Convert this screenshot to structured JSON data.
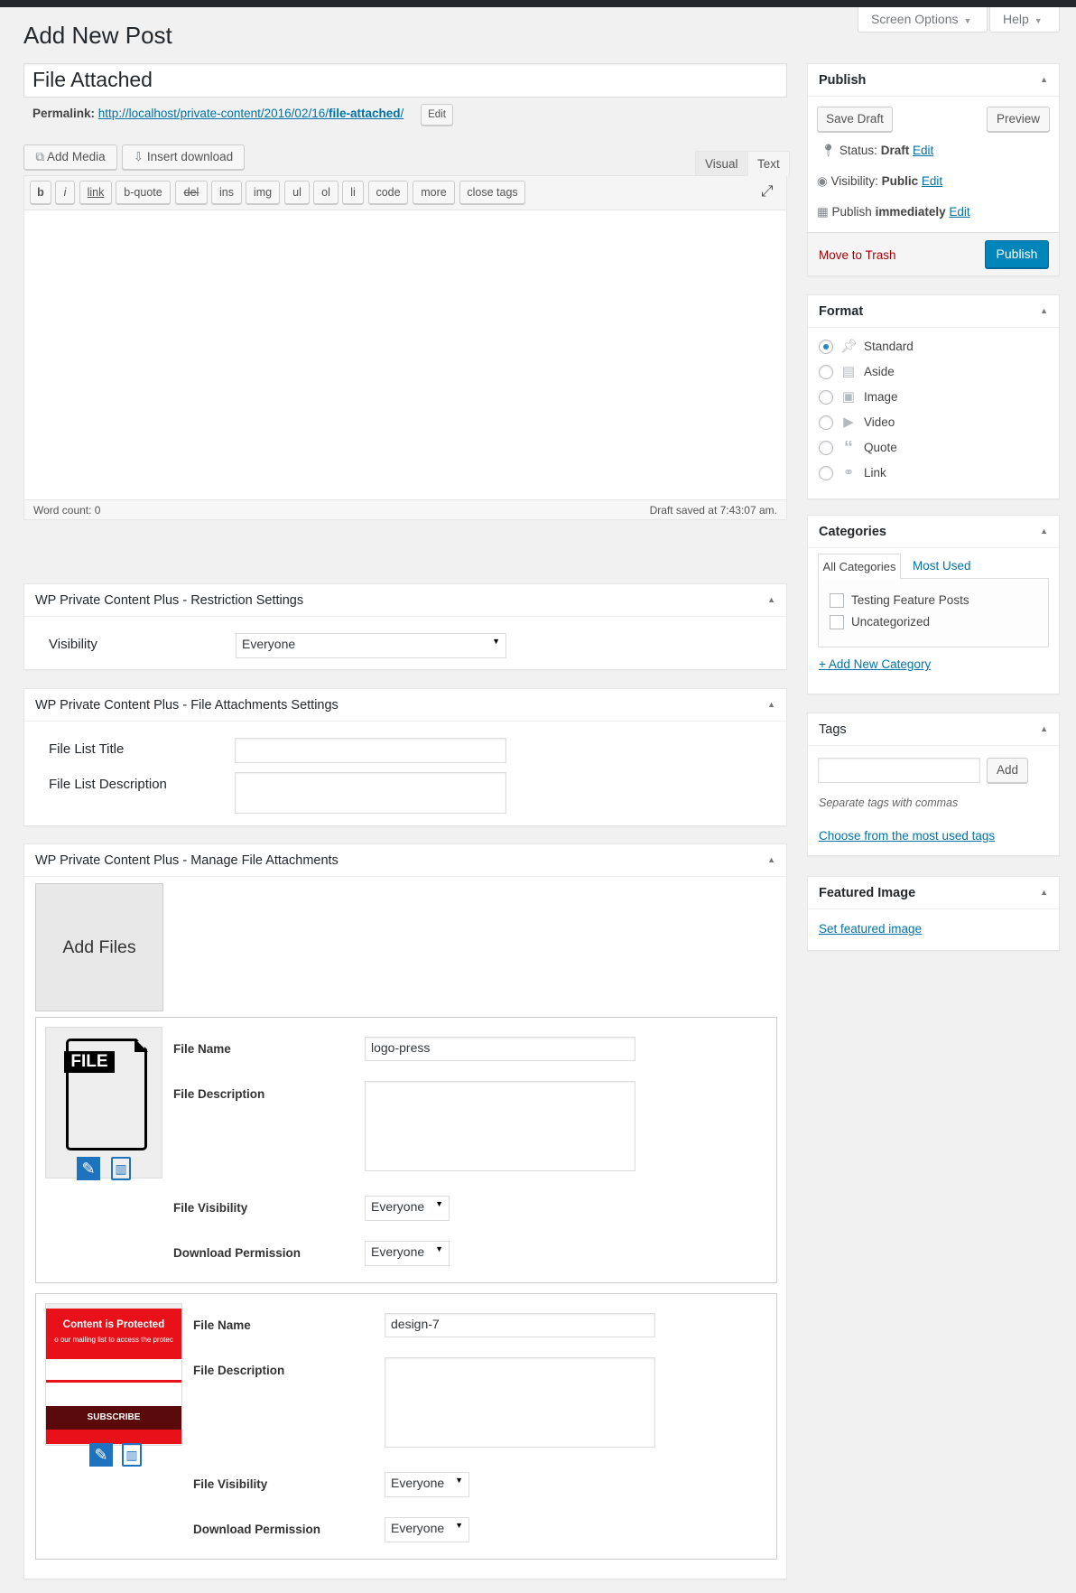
{
  "screen_options": {
    "label": "Screen Options",
    "help": "Help"
  },
  "page_title": "Add New Post",
  "post_title": "File Attached",
  "permalink": {
    "label": "Permalink:",
    "url_base": "http://localhost/private-content/2016/02/16/",
    "slug": "file-attached",
    "slug_suffix": "/",
    "edit": "Edit"
  },
  "media_buttons": {
    "add_media": "Add Media",
    "insert_download": "Insert download"
  },
  "editor_tabs": {
    "visual": "Visual",
    "text": "Text"
  },
  "quicktags": [
    "b",
    "i",
    "link",
    "b-quote",
    "del",
    "ins",
    "img",
    "ul",
    "ol",
    "li",
    "code",
    "more",
    "close tags"
  ],
  "statusbar": {
    "word_count": "Word count: 0",
    "draft_saved": "Draft saved at 7:43:07 am."
  },
  "restriction": {
    "title": "WP Private Content Plus - Restriction Settings",
    "visibility_label": "Visibility",
    "visibility_value": "Everyone"
  },
  "attachments_settings": {
    "title": "WP Private Content Plus - File Attachments Settings",
    "list_title_label": "File List Title",
    "list_desc_label": "File List Description"
  },
  "manage": {
    "title": "WP Private Content Plus - Manage File Attachments",
    "add_files": "Add Files",
    "files": [
      {
        "thumb_text": "FILE",
        "name_label": "File Name",
        "name_value": "logo-press",
        "desc_label": "File Description",
        "vis_label": "File Visibility",
        "vis_value": "Everyone",
        "perm_label": "Download Permission",
        "perm_value": "Everyone"
      },
      {
        "thumb_title": "Content is Protected",
        "thumb_sub": "o our mailing list to access the protec",
        "thumb_btn": "SUBSCRIBE",
        "name_label": "File Name",
        "name_value": "design-7",
        "desc_label": "File Description",
        "vis_label": "File Visibility",
        "vis_value": "Everyone",
        "perm_label": "Download Permission",
        "perm_value": "Everyone"
      }
    ]
  },
  "publish": {
    "title": "Publish",
    "save_draft": "Save Draft",
    "preview": "Preview",
    "status_label": "Status:",
    "status_value": "Draft",
    "visibility_label": "Visibility:",
    "visibility_value": "Public",
    "schedule_label": "Publish",
    "schedule_value": "immediately",
    "edit": "Edit",
    "trash": "Move to Trash",
    "publish_btn": "Publish"
  },
  "format": {
    "title": "Format",
    "options": [
      "Standard",
      "Aside",
      "Image",
      "Video",
      "Quote",
      "Link"
    ],
    "selected": "Standard"
  },
  "categories": {
    "title": "Categories",
    "tab_all": "All Categories",
    "tab_used": "Most Used",
    "items": [
      "Testing Feature Posts",
      "Uncategorized"
    ],
    "add_new": "+ Add New Category"
  },
  "tags": {
    "title": "Tags",
    "add": "Add",
    "hint": "Separate tags with commas",
    "choose": "Choose from the most used tags"
  },
  "featured": {
    "title": "Featured Image",
    "set": "Set featured image"
  },
  "colors": {
    "primary": "#0085ba",
    "trash": "#a00",
    "file_icon": "#1e73be",
    "thumb_red": "#e8111a"
  }
}
